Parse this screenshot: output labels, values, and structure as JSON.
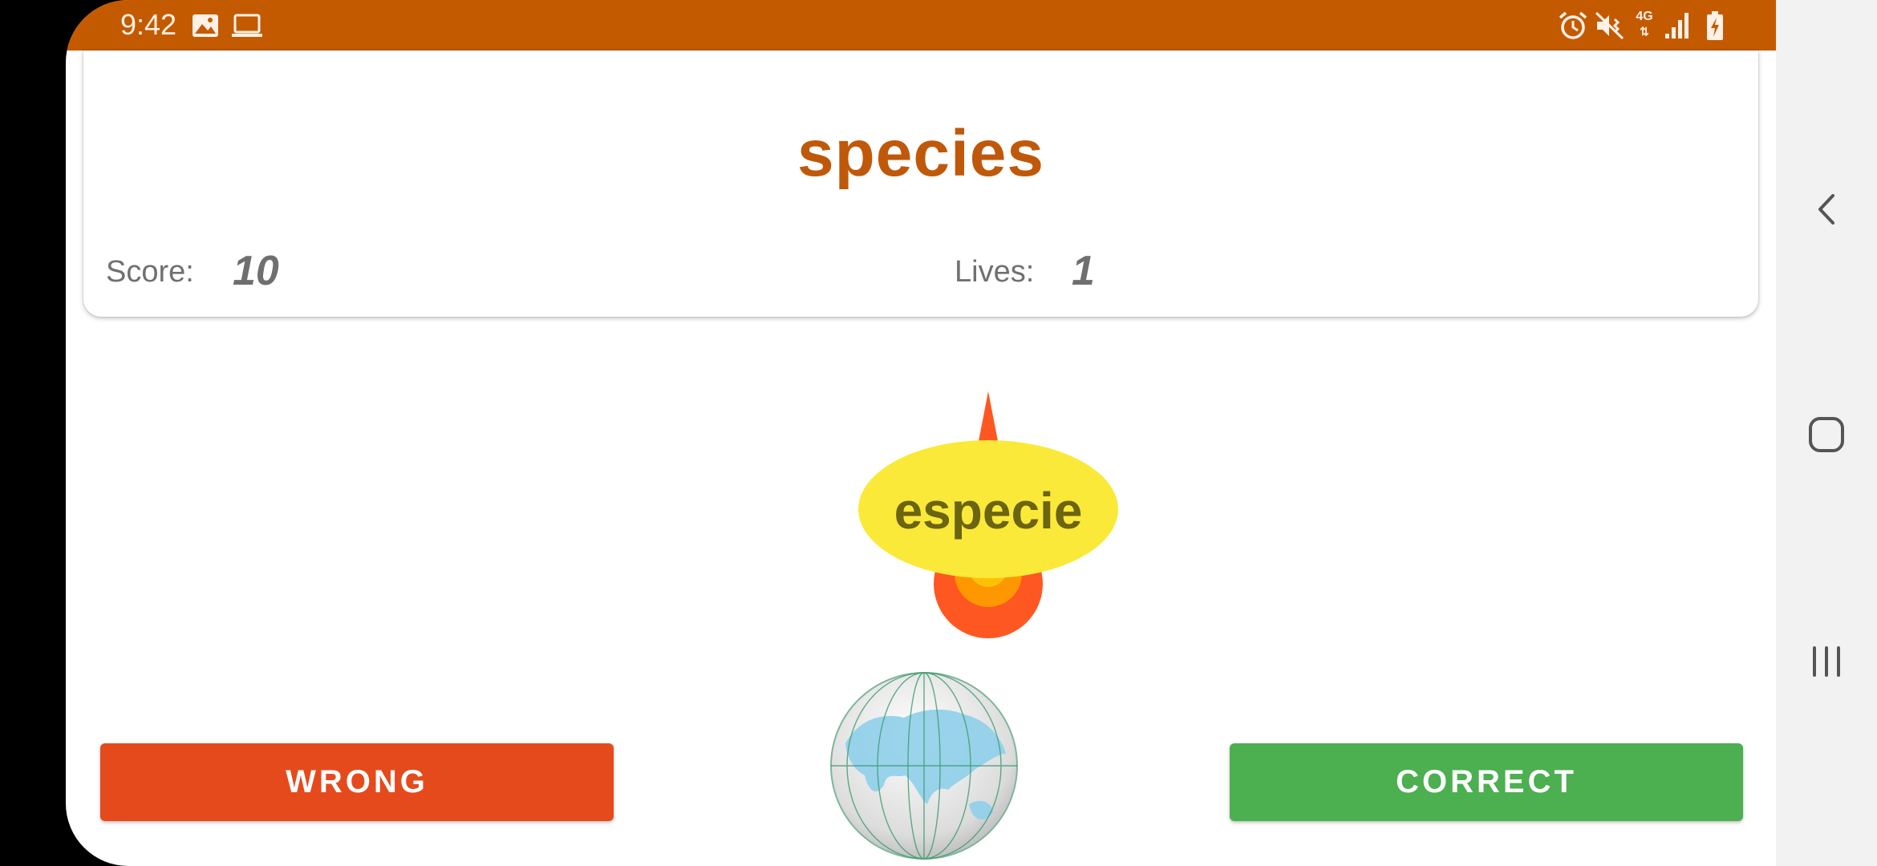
{
  "status_bar": {
    "time": "9:42",
    "network": "4G",
    "left_icons": [
      "gallery-icon",
      "laptop-icon"
    ],
    "right_icons": [
      "alarm-icon",
      "mute-icon",
      "signal-icon",
      "battery-charging-icon"
    ]
  },
  "card": {
    "target_word": "species",
    "score_label": "Score:",
    "score_value": "10",
    "lives_label": "Lives:",
    "lives_value": "1"
  },
  "game": {
    "falling_word": "especie"
  },
  "buttons": {
    "wrong_label": "WRONG",
    "correct_label": "CORRECT"
  },
  "colors": {
    "status_bar": "#c45a00",
    "title": "#c0580a",
    "wrong": "#e54a1c",
    "correct": "#4caf50",
    "bubble": "#fbe93a"
  },
  "nav_bar": [
    "back-icon",
    "home-icon",
    "recents-icon"
  ]
}
